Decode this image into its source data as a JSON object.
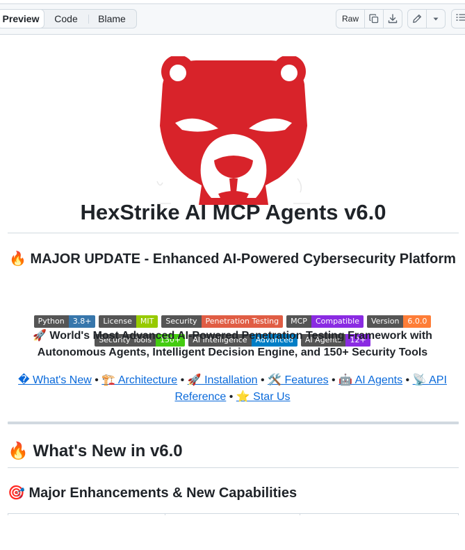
{
  "toolbar": {
    "tabs": [
      "Preview",
      "Code",
      "Blame"
    ],
    "raw_label": "Raw",
    "icons": [
      "copy-icon",
      "download-icon",
      "pencil-icon",
      "triangle-down-icon",
      "list-icon"
    ]
  },
  "readme": {
    "title": "HexStrike AI MCP Agents v6.0",
    "update_heading": "🔥 MAJOR UPDATE - Enhanced AI-Powered Cybersecurity Platform",
    "badges_row1": [
      {
        "label": "Python",
        "value": "3.8+",
        "color": "#3776ab"
      },
      {
        "label": "License",
        "value": "MIT",
        "color": "#97ca00"
      },
      {
        "label": "Security",
        "value": "Penetration Testing",
        "color": "#e05d44"
      },
      {
        "label": "MCP",
        "value": "Compatible",
        "color": "#8a2be2"
      },
      {
        "label": "Version",
        "value": "6.0.0",
        "color": "#fe7d37"
      }
    ],
    "badges_row2": [
      {
        "label": "Security Tools",
        "value": "150+",
        "color": "#44cc11"
      },
      {
        "label": "AI Intelligence",
        "value": "Advanced",
        "color": "#007ec6"
      },
      {
        "label": "AI Agents",
        "value": "12+",
        "color": "#8a2be2"
      }
    ],
    "tagline": "🚀 World's Most Advanced AI-Powered Penetration Testing Framework with Autonomous Agents, Intelligent Decision Engine, and 150+ Security Tools",
    "nav_links": [
      "� What's New",
      "🏗️ Architecture",
      "🚀 Installation",
      "🛠️ Features",
      "🤖 AI Agents",
      "📡 API Reference",
      "⭐ Star Us"
    ],
    "nav_separator": "•",
    "whats_new_heading": "🔥 What's New in v6.0",
    "enhancements_heading": "🎯 Major Enhancements & New Capabilities"
  },
  "colors": {
    "logo_red": "#d8232a",
    "link": "#0969da"
  }
}
